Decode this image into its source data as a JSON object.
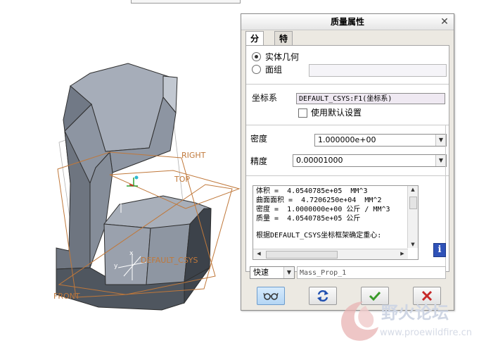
{
  "viewport": {
    "datum_labels": {
      "right": "RIGHT",
      "top": "TOP",
      "csys": "DEFAULT_CSYS",
      "front": "FRONT"
    },
    "axis_labels": {
      "x": "x",
      "y": "y"
    }
  },
  "dialog": {
    "title": "质量属性",
    "close_icon": "close-x",
    "tabs": [
      {
        "label": "分析",
        "active": true
      },
      {
        "label": "特征",
        "active": false
      }
    ],
    "geometry_options": {
      "solid_label": "实体几何",
      "solid_selected": true,
      "quilt_label": "面组",
      "quilt_selected": false,
      "quilt_value": ""
    },
    "coord_system": {
      "label": "坐标系",
      "value": "DEFAULT_CSYS:F1(坐标系)",
      "use_default_label": "使用默认设置",
      "use_default_checked": false
    },
    "density": {
      "label": "密度",
      "value": "1.000000e+00"
    },
    "accuracy": {
      "label": "精度",
      "value": "0.00001000"
    },
    "results": {
      "lines": [
        "体积 =  4.0540785e+05  MM^3",
        "曲面面积 =  4.7206250e+04  MM^2",
        "密度 =  1.0000000e+00 公斤 / MM^3",
        "质量 =  4.0540785e+05 公斤"
      ],
      "footer_line": "根据DEFAULT_CSYS坐标框架确定重心:"
    },
    "info_icon": "i",
    "mode": {
      "value": "快速"
    },
    "feature_name": {
      "value": "Mass_Prop_1"
    },
    "buttons": [
      {
        "name": "preview",
        "icon": "glasses-icon"
      },
      {
        "name": "repaint",
        "icon": "refresh-icon"
      },
      {
        "name": "ok",
        "icon": "check-icon"
      },
      {
        "name": "cancel",
        "icon": "x-icon"
      }
    ]
  },
  "watermark": {
    "title": "野火论坛",
    "url": "www.proewildfire.cn"
  },
  "colors": {
    "model_face_top": "#9aa2b0",
    "model_face_side": "#5f6670",
    "datum_orange": "#c0783a",
    "ok_green": "#3a9a2a",
    "cancel_red": "#c62828",
    "info_blue": "#2f52b8"
  }
}
